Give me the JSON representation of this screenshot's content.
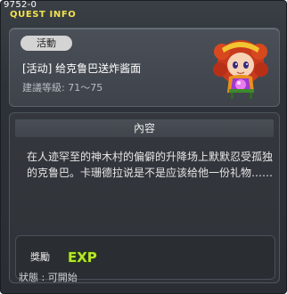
{
  "window": {
    "id_text": "9752-0",
    "title": "QUEST INFO"
  },
  "quest": {
    "category_badge": "活動",
    "name": "[活动] 给克鲁巴送炸酱面",
    "level_label": "建議等級",
    "level_value": "71～75",
    "level_text": "建議等級: 71～75"
  },
  "content": {
    "header": "內容",
    "description": "在人迹罕至的神木村的偏僻的升降场上默默忍受孤独的克鲁巴。卡珊德拉说是不是应该给他一份礼物……"
  },
  "reward": {
    "label": "獎勵",
    "item": "EXP"
  },
  "status": {
    "text": "狀態 : 可開始"
  },
  "colors": {
    "title": "#f2e24b",
    "exp_fill": "#b6e62a"
  }
}
